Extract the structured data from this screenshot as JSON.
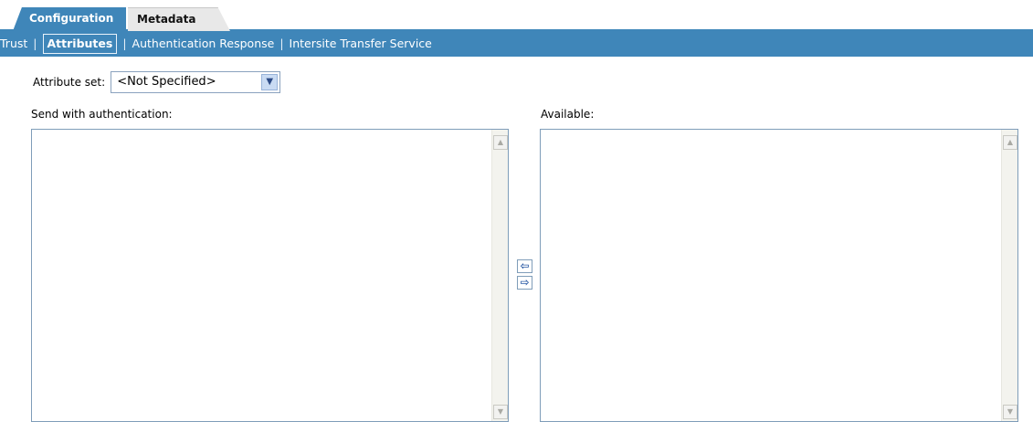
{
  "tabs": {
    "configuration": "Configuration",
    "metadata": "Metadata"
  },
  "subnav": {
    "items": [
      "Trust",
      "Attributes",
      "Authentication Response",
      "Intersite Transfer Service"
    ],
    "separator": "|",
    "active": "Attributes"
  },
  "attribute_set": {
    "label": "Attribute set:",
    "selected": "<Not Specified>"
  },
  "send_list": {
    "label": "Send with authentication:"
  },
  "available_list": {
    "label": "Available:"
  },
  "icons": {
    "move_left": "arrow-left-icon",
    "move_right": "arrow-right-icon",
    "dropdown": "chevron-down-icon",
    "scroll_up": "scroll-up-icon",
    "scroll_down": "scroll-down-icon"
  },
  "colors": {
    "accent": "#3f86b9",
    "tab_inactive": "#e8e8e8",
    "list_border": "#7f9db9"
  }
}
